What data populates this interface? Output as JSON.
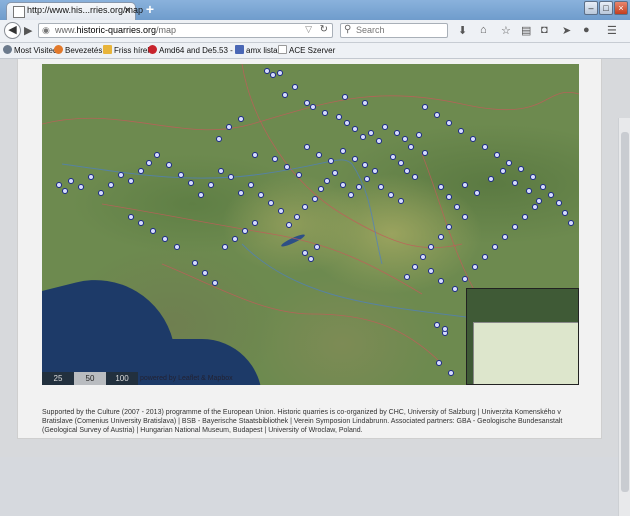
{
  "browser": {
    "tab_title": "http://www.his...rries.org/map",
    "new_tab_symbol": "+",
    "url_prefix": "www.",
    "url_domain": "historic-quarries.org",
    "url_path": "/map",
    "search_placeholder": "Search"
  },
  "bookmarks": [
    {
      "label": "Most Visited",
      "icon": "gear-icon",
      "color": "#6b7a8c"
    },
    {
      "label": "Bevezetés",
      "icon": "firefox-icon",
      "color": "#e2792b"
    },
    {
      "label": "Friss hírek",
      "icon": "folder-icon",
      "color": "#e8b43a"
    },
    {
      "label": "Amd64 and De5.53 - ...",
      "icon": "star-burst-icon",
      "color": "#c8232c"
    },
    {
      "label": "amx lista",
      "icon": "grid-icon",
      "color": "#4a67b5"
    },
    {
      "label": "ACE Szerver",
      "icon": "page-icon",
      "color": "#999999"
    }
  ],
  "map": {
    "scale_labels": [
      "25",
      "50",
      "100"
    ],
    "powered_text": "powered by Leaflet & Mapbox",
    "marker_color": "#d7dcff"
  },
  "footer": {
    "text": "Supported by the Culture (2007 - 2013) programme of the European Union. Historic quarries is co-organized by CHC, University of Salzburg | Univerzita Komenského v Bratislave (Comenius University Bratislava) | BSB - Bayerische Staatsbibliothek | Verein Symposion Lindabrunn. Associated partners: GBA - Geologische Bundesanstalt (Geological Survey of Austria) | Hungarian National Museum, Budapest | University of Wroclaw, Poland."
  }
}
